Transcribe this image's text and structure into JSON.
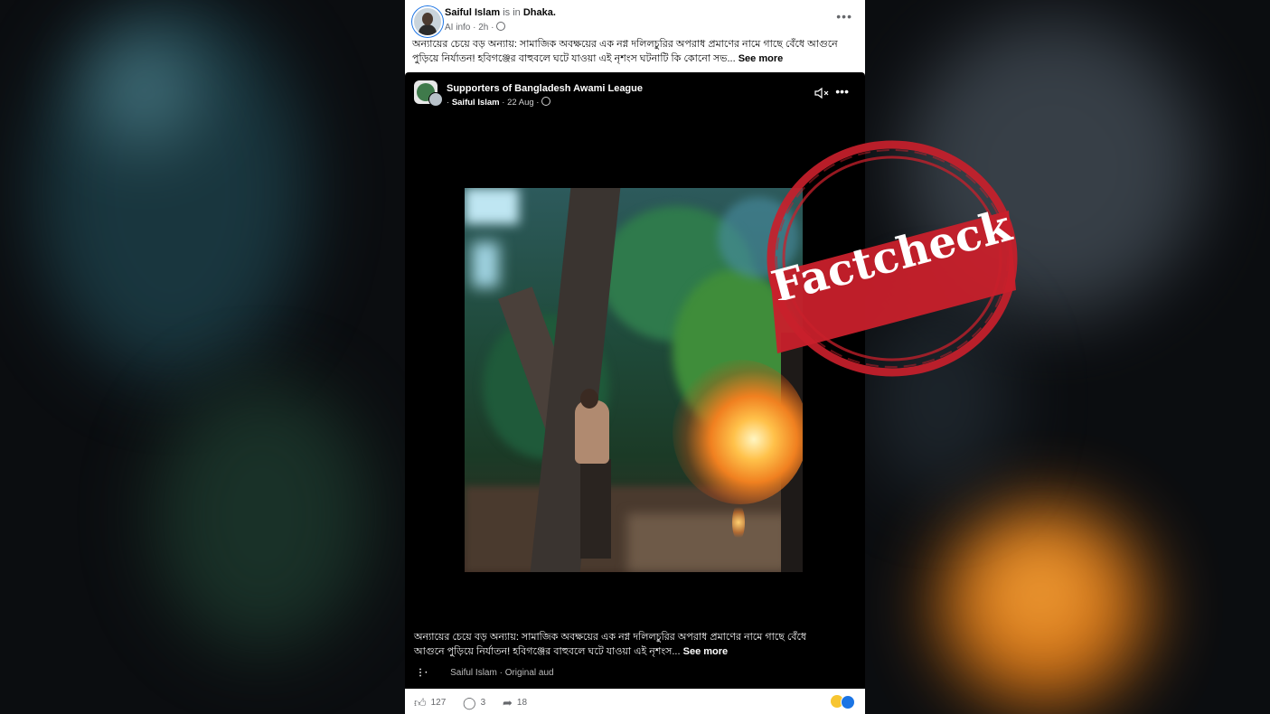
{
  "post": {
    "author": "Saiful Islam",
    "is_in": "is in",
    "location": "Dhaka.",
    "meta": "AI info · 2h ·",
    "caption": "অন্যায়ের চেয়ে বড় অন্যায়: সামাজিক অবক্ষয়ের এক নগ্ন দলিলচুরির অপরাধ প্রমাণের নামে গাছে বেঁধে আগুনে পুড়িয়ে নির্যাতন! হবিগঞ্জের বাহুবলে ঘটে যাওয়া এই নৃশংস ঘটনাটি কি কোনো সভ...",
    "see_more": "See more",
    "more_icon": "more-icon"
  },
  "shared": {
    "page_name": "Supporters of Bangladesh Awami League",
    "author": "Saiful Islam",
    "date": " · 22 Aug ·",
    "caption": "অন্যায়ের চেয়ে বড় অন্যায়: সামাজিক অবক্ষয়ের এক নগ্ন দলিলচুরির অপরাধ প্রমাণের নামে গাছে বেঁধে আগুনে পুড়িয়ে নির্যাতন! হবিগঞ্জের বাহুবলে ঘটে যাওয়া এই নৃশংস...",
    "see_more": "See more",
    "audio": "Saiful Islam · Original aud",
    "audio_icon": "audio-wave-icon",
    "mute_icon": "muted-speaker-icon"
  },
  "actions": {
    "likes": "127",
    "comments": "3",
    "shares": "18",
    "like_icon": "thumbs-up-icon",
    "comment_icon": "comment-icon",
    "share_icon": "share-icon"
  },
  "stamp": {
    "text": "Factcheck",
    "color": "#c8202b"
  },
  "colors": {
    "facebook_blue": "#1b74e4",
    "muted_text": "#65676b"
  }
}
